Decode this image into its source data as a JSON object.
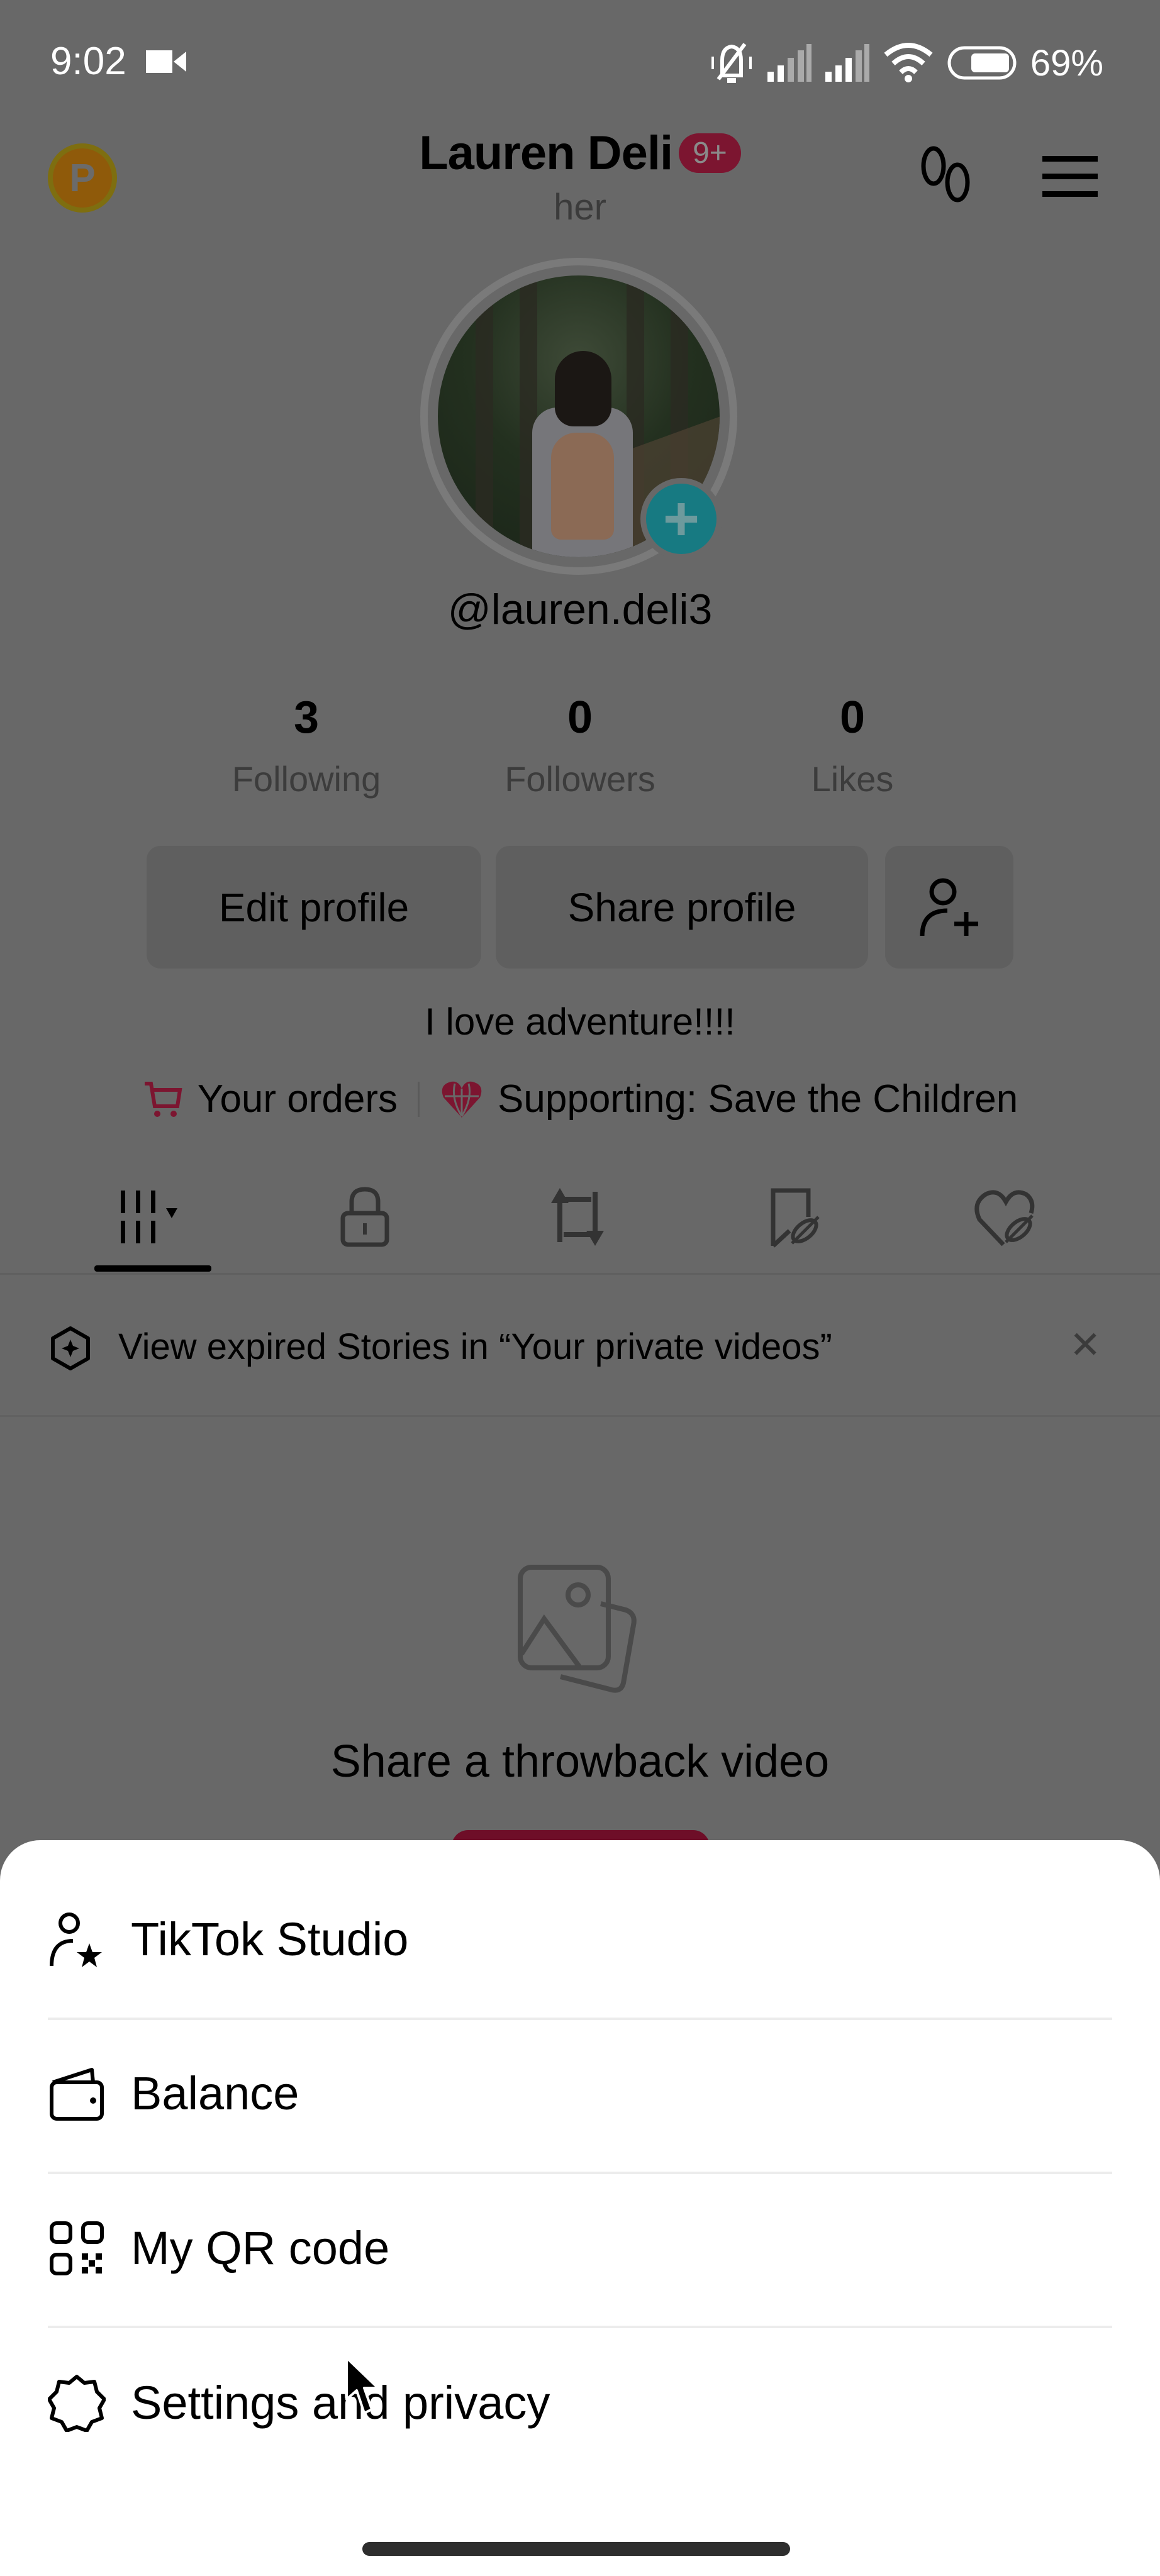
{
  "status_bar": {
    "time": "9:02",
    "battery_percent": "69%",
    "icons": [
      "video-record-icon",
      "silent-mode-icon",
      "signal-icon",
      "signal-icon",
      "wifi-icon",
      "battery-icon"
    ]
  },
  "header": {
    "display_name": "Lauren Deli",
    "notification_badge": "9+",
    "pronouns": "her",
    "coin_label": "P",
    "icons": [
      "p-coin-icon",
      "footprints-icon",
      "hamburger-menu-icon"
    ]
  },
  "profile": {
    "username": "@lauren.deli3",
    "stats": [
      {
        "value": "3",
        "label": "Following"
      },
      {
        "value": "0",
        "label": "Followers"
      },
      {
        "value": "0",
        "label": "Likes"
      }
    ],
    "buttons": {
      "edit": "Edit profile",
      "share": "Share profile"
    },
    "bio": "I love adventure!!!!",
    "orders_link": "Your orders",
    "supporting_link": "Supporting: Save the Children"
  },
  "tabs": [
    {
      "name": "videos",
      "icon": "grid-icon",
      "active": true
    },
    {
      "name": "private",
      "icon": "lock-icon",
      "active": false
    },
    {
      "name": "reposts",
      "icon": "repost-icon",
      "active": false
    },
    {
      "name": "favorites",
      "icon": "bookmark-hidden-icon",
      "active": false
    },
    {
      "name": "liked",
      "icon": "heart-hidden-icon",
      "active": false
    }
  ],
  "banner": {
    "text": "View expired Stories in “Your private videos”",
    "close": "✕"
  },
  "empty_state": {
    "title": "Share a throwback video"
  },
  "sheet": {
    "items": [
      {
        "label": "TikTok Studio",
        "icon": "creator-star-icon"
      },
      {
        "label": "Balance",
        "icon": "wallet-icon"
      },
      {
        "label": "My QR code",
        "icon": "qr-code-icon"
      },
      {
        "label": "Settings and privacy",
        "icon": "settings-gear-icon"
      }
    ]
  },
  "colors": {
    "scrim": "#686868",
    "accent": "#7c1530",
    "teal": "#177a82",
    "sheet_bg": "#ffffff"
  }
}
